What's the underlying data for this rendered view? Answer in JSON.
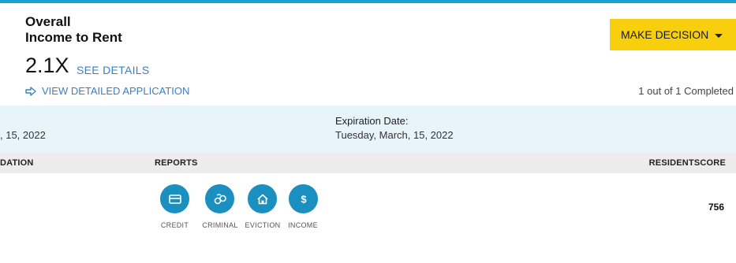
{
  "summary": {
    "title_line1": "Overall",
    "title_line2": "Income to Rent",
    "ratio": "2.1X",
    "see_details": "SEE DETAILS",
    "view_application": "VIEW DETAILED APPLICATION",
    "decision_button": "MAKE DECISION",
    "completed_status": "1 out of 1 Completed"
  },
  "dates": {
    "left_value": ", 15, 2022",
    "expiration_label": "Expiration Date:",
    "expiration_value": "Tuesday, March, 15, 2022"
  },
  "table": {
    "headers": {
      "recommendation": "DATION",
      "reports": "REPORTS",
      "residentscore": "RESIDENTSCORE"
    },
    "reports": [
      {
        "label": "CREDIT",
        "icon": "credit-card-icon"
      },
      {
        "label": "CRIMINAL",
        "icon": "handcuffs-icon"
      },
      {
        "label": "EVICTION",
        "icon": "house-icon"
      },
      {
        "label": "INCOME",
        "icon": "dollar-icon"
      }
    ],
    "residentscore_value": "756"
  },
  "colors": {
    "accent_blue": "#1a9fd3",
    "icon_blue": "#1b8fbf",
    "link_blue": "#3a7fc0",
    "decision_yellow": "#f7cf0c",
    "date_band": "#e7f4f9"
  }
}
